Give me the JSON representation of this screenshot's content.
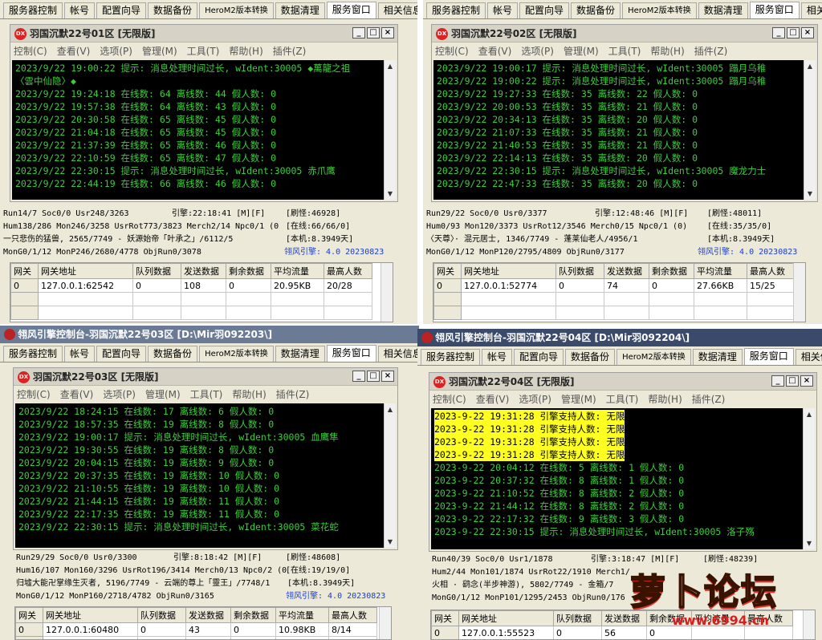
{
  "tabs": [
    "服务器控制",
    "帐号",
    "配置向导",
    "数据备份",
    "HeroM2版本转换",
    "数据清理",
    "服务窗口",
    "相关信息"
  ],
  "active_tab": "服务窗口",
  "menu": [
    "控制(C)",
    "查看(V)",
    "选项(P)",
    "管理(M)",
    "工具(T)",
    "帮助(H)",
    "插件(Z)"
  ],
  "win_buttons": [
    "_",
    "□",
    "×"
  ],
  "grid_headers": [
    "网关",
    "网关地址",
    "队列数据",
    "发送数据",
    "剩余数据",
    "平均流量",
    "最高人数"
  ],
  "panels": [
    {
      "id": "q1",
      "inner_title": "羽国沉默22号01区 [无限版]",
      "console": [
        "2023/9/22 19:00:22 提示: 消息处理时间过长, wIdent:30005 ◆萬龍之祖",
        "〈雲中仙隐〉◆",
        "2023/9/22 19:24:18 在线数: 64 离线数: 44 假人数: 0",
        "2023/9/22 19:57:38 在线数: 64 离线数: 43 假人数: 0",
        "2023/9/22 20:30:58 在线数: 65 离线数: 45 假人数: 0",
        "2023/9/22 21:04:18 在线数: 65 离线数: 45 假人数: 0",
        "2023/9/22 21:37:39 在线数: 65 离线数: 46 假人数: 0",
        "2023/9/22 22:10:59 在线数: 65 离线数: 47 假人数: 0",
        "2023/9/22 22:30:15 提示: 消息处理时间过长, wIdent:30005 赤爪鹰",
        "2023/9/22 22:44:19 在线数: 66 离线数: 46 假人数: 0"
      ],
      "status": {
        "r1a": "Run14/7 Soc0/0 Usr248/3263",
        "r1b": "引擎:22:18:41 [M][F]",
        "r1c": "[刷怪:46928]",
        "r2a": "Hum138/286 Mon246/3258 UsrRot773/3823 Merch2/14 Npc0/1 (0",
        "r2b": "[在线:66/66/0]",
        "r3a": "一只悲伤的猛兽, 2565/7749 - 妖源始帝「叶承之」/6112/5",
        "r3b": "[本机:8.3949天]",
        "r4a": "MonG0/1/12 MonP246/2680/4778 ObjRun0/3078",
        "r4b": "翎风引擎: 4.0 20230823"
      },
      "grid_row": [
        "0",
        "127.0.0.1:62542",
        "0",
        "108",
        "0",
        "20.95KB",
        "20/28"
      ]
    },
    {
      "id": "q2",
      "inner_title": "羽国沉默22号02区 [无限版]",
      "console": [
        "2023/9/22 19:00:17 提示: 消息处理时间过长, wIdent:30005 蹋月乌稚",
        "2023/9/22 19:00:22 提示: 消息处理时间过长, wIdent:30005 蹋月乌稚",
        "2023/9/22 19:27:33 在线数: 35 离线数: 22 假人数: 0",
        "2023/9/22 20:00:53 在线数: 35 离线数: 21 假人数: 0",
        "2023/9/22 20:34:13 在线数: 35 离线数: 20 假人数: 0",
        "2023/9/22 21:07:33 在线数: 35 离线数: 21 假人数: 0",
        "2023/9/22 21:40:53 在线数: 35 离线数: 21 假人数: 0",
        "2023/9/22 22:14:13 在线数: 35 离线数: 20 假人数: 0",
        "2023/9/22 22:30:15 提示: 消息处理时间过长, wIdent:30005 魔龙力士",
        "2023/9/22 22:47:33 在线数: 35 离线数: 20 假人数: 0"
      ],
      "status": {
        "r1a": "Run29/22 Soc0/0 Usr0/3377",
        "r1b": "引擎:12:48:46 [M][F]",
        "r1c": "[刷怪:48011]",
        "r2a": "Hum0/93 Mon120/3373 UsrRot12/3546 Merch0/15 Npc0/1 (0)",
        "r2b": "[在线:35/35/0]",
        "r3a": "〈天尊〉· 混元居士, 1346/7749 - 蓬莱仙老人/4956/1",
        "r3b": "[本机:8.3949天]",
        "r4a": "MonG0/1/12 MonP120/2795/4809 ObjRun0/3177",
        "r4b": "翎风引擎: 4.0 20230823"
      },
      "grid_row": [
        "0",
        "127.0.0.1:52774",
        "0",
        "74",
        "0",
        "27.66KB",
        "15/25"
      ]
    },
    {
      "id": "q3",
      "outer_title": "翎风引擎控制台-羽国沉默22号03区 [D:\\Mir羽092203\\]",
      "inner_title": "羽国沉默22号03区 [无限版]",
      "console": [
        "2023/9/22 18:24:15 在线数: 17 离线数: 6 假人数: 0",
        "2023/9/22 18:57:35 在线数: 19 离线数: 8 假人数: 0",
        "2023/9/22 19:00:17 提示: 消息处理时间过长, wIdent:30005 血鹰隼",
        "2023/9/22 19:30:55 在线数: 19 离线数: 8 假人数: 0",
        "2023/9/22 20:04:15 在线数: 19 离线数: 9 假人数: 0",
        "2023/9/22 20:37:35 在线数: 19 离线数: 10 假人数: 0",
        "2023/9/22 21:10:55 在线数: 19 离线数: 10 假人数: 0",
        "2023/9/22 21:44:15 在线数: 19 离线数: 11 假人数: 0",
        "2023/9/22 22:17:35 在线数: 19 离线数: 11 假人数: 0",
        "2023/9/22 22:30:15 提示: 消息处理时间过长, wIdent:30005 菜花蛇"
      ],
      "status": {
        "r1a": "Run29/29 Soc0/0 Usr0/3300",
        "r1b": "引擎:8:18:42 [M][F]",
        "r1c": "[刷怪:48608]",
        "r2a": "Hum16/107 Mon160/3296 UsrRot196/3414 Merch0/13 Npc0/2 (0",
        "r2b": "[在线:19/19/0]",
        "r3a": "归墟大能卍掌缘生灭者, 5196/7749 - 云端的尊上「靈王」/7748/1",
        "r3b": "[本机:8.3949天]",
        "r4a": "MonG0/1/12 MonP160/2718/4782 ObjRun0/3165",
        "r4b": "翎风引擎: 4.0 20230823"
      },
      "grid_row": [
        "0",
        "127.0.0.1:60480",
        "0",
        "43",
        "0",
        "10.98KB",
        "8/14"
      ]
    },
    {
      "id": "q4",
      "outer_title": "翎风引擎控制台-羽国沉默22号04区 [D:\\Mir羽092204\\]",
      "inner_title": "羽国沉默22号04区 [无限版]",
      "console": [
        "2023-9-22 19:31:28 引擎支持人数: 无限",
        "2023-9-22 19:31:28 引擎支持人数: 无限",
        "2023-9-22 19:31:28 引擎支持人数: 无限",
        "2023-9-22 19:31:28 引擎支持人数: 无限",
        "2023-9-22 20:04:12 在线数: 5 离线数: 1 假人数: 0",
        "2023-9-22 20:37:32 在线数: 8 离线数: 1 假人数: 0",
        "2023-9-22 21:10:52 在线数: 8 离线数: 2 假人数: 0",
        "2023-9-22 21:44:12 在线数: 8 离线数: 2 假人数: 0",
        "2023-9-22 22:17:32 在线数: 9 离线数: 3 假人数: 0",
        "2023-9-22 22:30:15 提示: 消息处理时间过长, wIdent:30005 洛子殇"
      ],
      "status": {
        "r1a": "Run40/39 Soc0/0 Usr1/1878",
        "r1b": "引擎:3:18:47 [M][F]",
        "r1c": "[刷怪:48239]",
        "r2a": "Hum2/44 Mon101/1874 UsrRot22/1910 Merch1/",
        "r2b": "",
        "r3a": "火相 · 鹞念(半步神游), 5802/7749 - 金箱/7",
        "r3b": "",
        "r4a": "MonG0/1/12 MonP101/1295/2453 ObjRun0/176",
        "r4b": ""
      },
      "grid_row": [
        "0",
        "127.0.0.1:55523",
        "0",
        "56",
        "0",
        "",
        ""
      ]
    }
  ],
  "watermark": {
    "text": "萝卜论坛",
    "url": "www.6994.cn"
  }
}
